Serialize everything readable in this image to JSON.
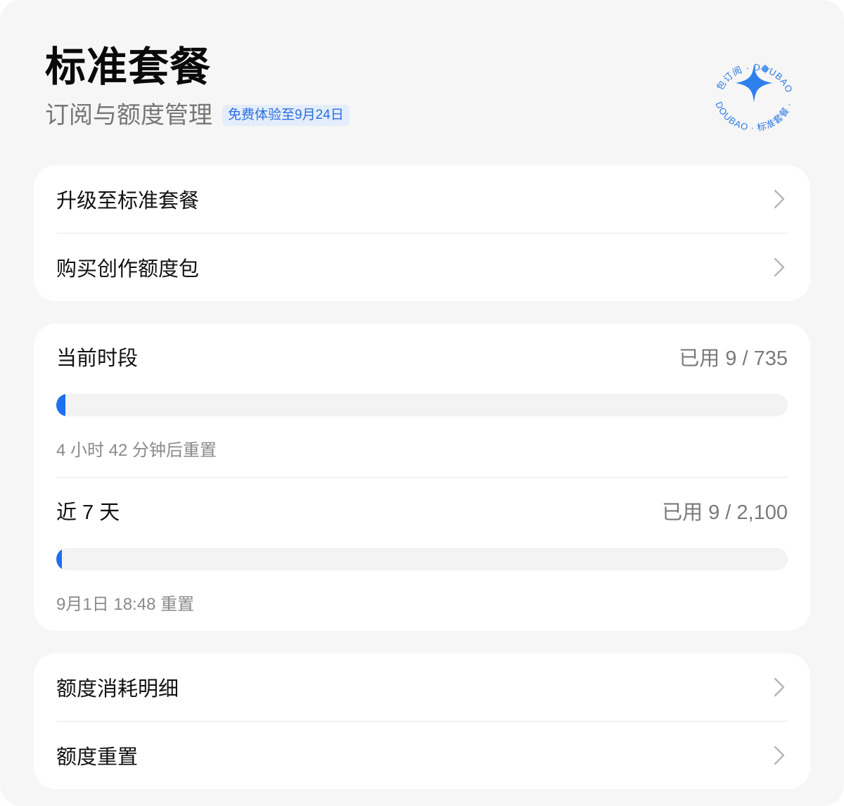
{
  "header": {
    "title": "标准套餐",
    "subtitle": "订阅与额度管理",
    "trial_badge": "免费体验至9月24日"
  },
  "seal": {
    "text_top": "豆包订阅 · DOUBAO ·",
    "text_bottom": "DOUBAO · 标准套餐 ·",
    "icon": "sparkle-icon",
    "color": "#2b78e4"
  },
  "actions_top": [
    {
      "label": "升级至标准套餐",
      "icon": "chevron-right-icon"
    },
    {
      "label": "购买创作额度包",
      "icon": "chevron-right-icon"
    }
  ],
  "usage": {
    "current_period": {
      "label": "当前时段",
      "used_text": "已用 9 / 735",
      "used": 9,
      "total": 735,
      "reset_text": "4 小时 42 分钟后重置"
    },
    "last_7_days": {
      "label": "近 7 天",
      "used_text": "已用 9 / 2,100",
      "used": 9,
      "total": 2100,
      "reset_text": "9月1日 18:48 重置"
    }
  },
  "actions_bottom": [
    {
      "label": "额度消耗明细",
      "icon": "chevron-right-icon"
    },
    {
      "label": "额度重置",
      "icon": "chevron-right-icon"
    }
  ],
  "colors": {
    "accent": "#1f6fef",
    "badge_bg": "#e4edfb",
    "badge_text": "#2b6fe0",
    "page_bg": "#f6f6f6"
  }
}
